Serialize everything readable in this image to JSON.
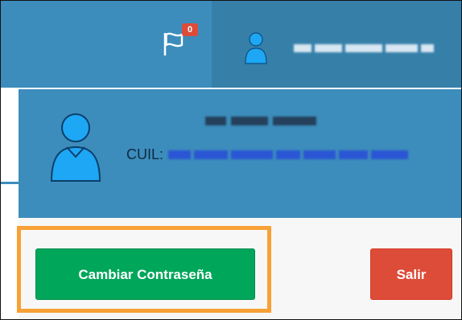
{
  "navbar": {
    "flag_icon": "flag-icon",
    "notification_count": "0",
    "user_icon": "user-icon"
  },
  "user_panel": {
    "avatar_icon": "user-icon",
    "cuil_label": "CUIL:"
  },
  "buttons": {
    "change_password": "Cambiar Contraseña",
    "logout": "Salir"
  },
  "colors": {
    "header_blue": "#3c8dbc",
    "header_blue_dark": "#367fa9",
    "success_green": "#00a65a",
    "danger_red": "#dd4b39",
    "highlight_orange": "#f7a136"
  }
}
